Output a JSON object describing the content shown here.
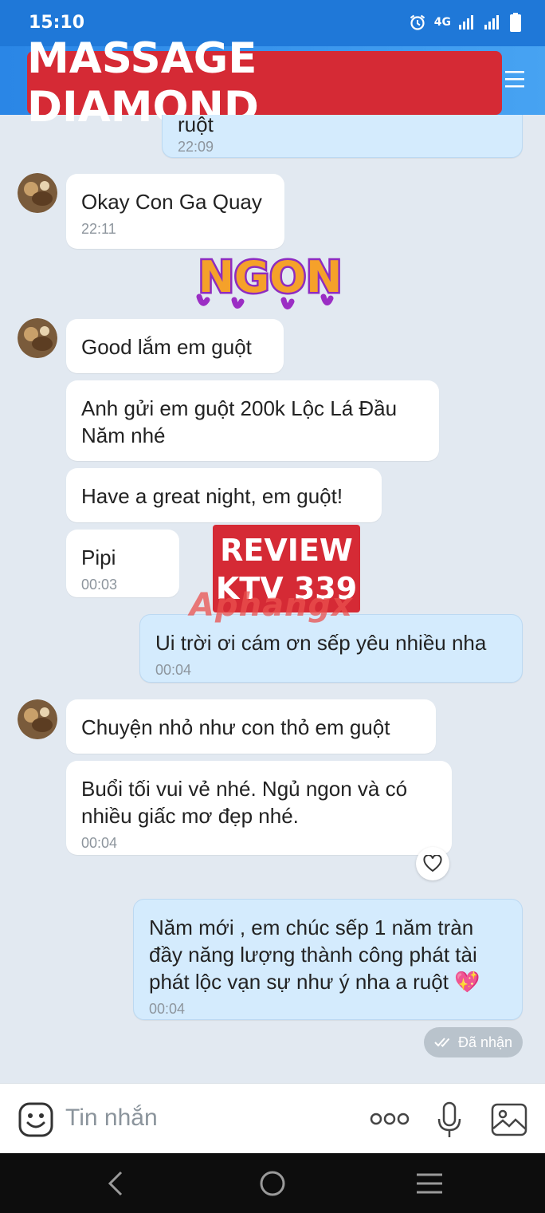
{
  "status_bar": {
    "time": "15:10",
    "network": "4G"
  },
  "header": {
    "banner_title": "MASSAGE DIAMOND",
    "icons": [
      "menu-icon"
    ]
  },
  "overlays": {
    "sticker_text": "NGON",
    "review_line1": "REVIEW",
    "review_line2": "KTV 339",
    "watermark": "Aphangx"
  },
  "messages": [
    {
      "side": "sent",
      "text": "ruột",
      "time": "22:09"
    },
    {
      "side": "received",
      "text": "Okay Con Ga Quay",
      "time": "22:11"
    },
    {
      "side": "received",
      "text": "Good lắm em guột",
      "time": ""
    },
    {
      "side": "received",
      "text": "Anh gửi em guột 200k Lộc Lá Đầu Năm nhé",
      "time": ""
    },
    {
      "side": "received",
      "text": "Have a great night, em guột!",
      "time": ""
    },
    {
      "side": "received",
      "text": "Pipi",
      "time": "00:03"
    },
    {
      "side": "sent",
      "text": "Ui trời ơi cám ơn sếp yêu nhiều nha",
      "time": "00:04"
    },
    {
      "side": "received",
      "text": "Chuyện nhỏ như con thỏ em guột",
      "time": ""
    },
    {
      "side": "received",
      "text": "Buổi tối vui vẻ nhé. Ngủ ngon và có nhiều giấc mơ đẹp nhé.",
      "time": "00:04"
    },
    {
      "side": "sent",
      "text": "Năm mới , em chúc sếp 1 năm tràn đầy năng lượng thành công phát tài phát lộc vạn sự như ý nha a ruột 💖",
      "time": "00:04"
    }
  ],
  "received_status": "Đã nhận",
  "input": {
    "placeholder": "Tin nhắn",
    "icons": [
      "emoji-icon",
      "more-icon",
      "microphone-icon",
      "image-icon"
    ]
  },
  "nav_icons": [
    "back-icon",
    "home-icon",
    "recents-icon"
  ],
  "colors": {
    "header_blue": "#1f78d8",
    "banner_red": "#d52a35",
    "sent_bubble": "#d4ebfd",
    "chat_bg": "#e2e9f1"
  }
}
